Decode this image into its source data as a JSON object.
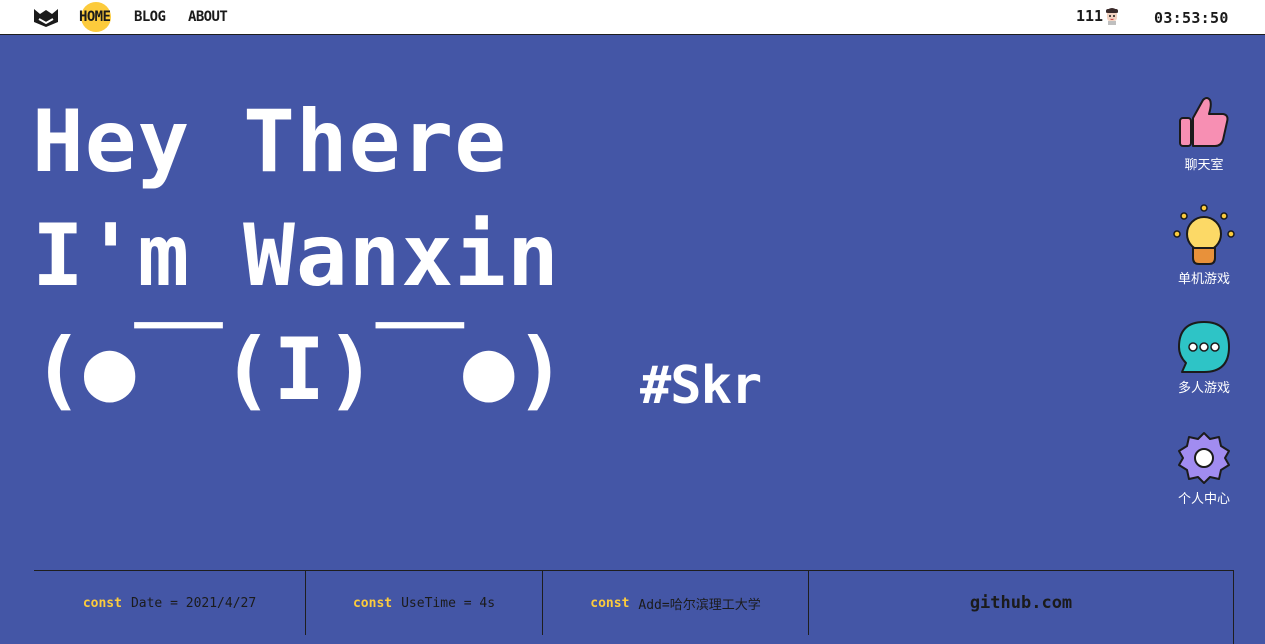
{
  "nav": {
    "items": [
      "HOME",
      "BLOG",
      "ABOUT"
    ],
    "active": "HOME",
    "visitor_count": "111",
    "clock": "03:53:50"
  },
  "hero": {
    "line1": "Hey There",
    "line2": "I'm Wanxin",
    "line3": "(●￣(I)￣●)",
    "hashtag": "#Skr"
  },
  "side_menu": [
    {
      "label": "聊天室",
      "icon": "thumbs-up-icon"
    },
    {
      "label": "单机游戏",
      "icon": "lightbulb-icon"
    },
    {
      "label": "多人游戏",
      "icon": "chat-bubble-icon"
    },
    {
      "label": "个人中心",
      "icon": "gear-icon"
    }
  ],
  "footer": {
    "keyword": "const",
    "date": "Date = 2021/4/27",
    "use_time": "UseTime = 4s",
    "address": "Add=哈尔滨理工大学",
    "link": "github.com"
  },
  "colors": {
    "background": "#4456a6",
    "accent": "#fccb3c",
    "topbar": "#ffffff",
    "text_dark": "#1b1b1b"
  }
}
